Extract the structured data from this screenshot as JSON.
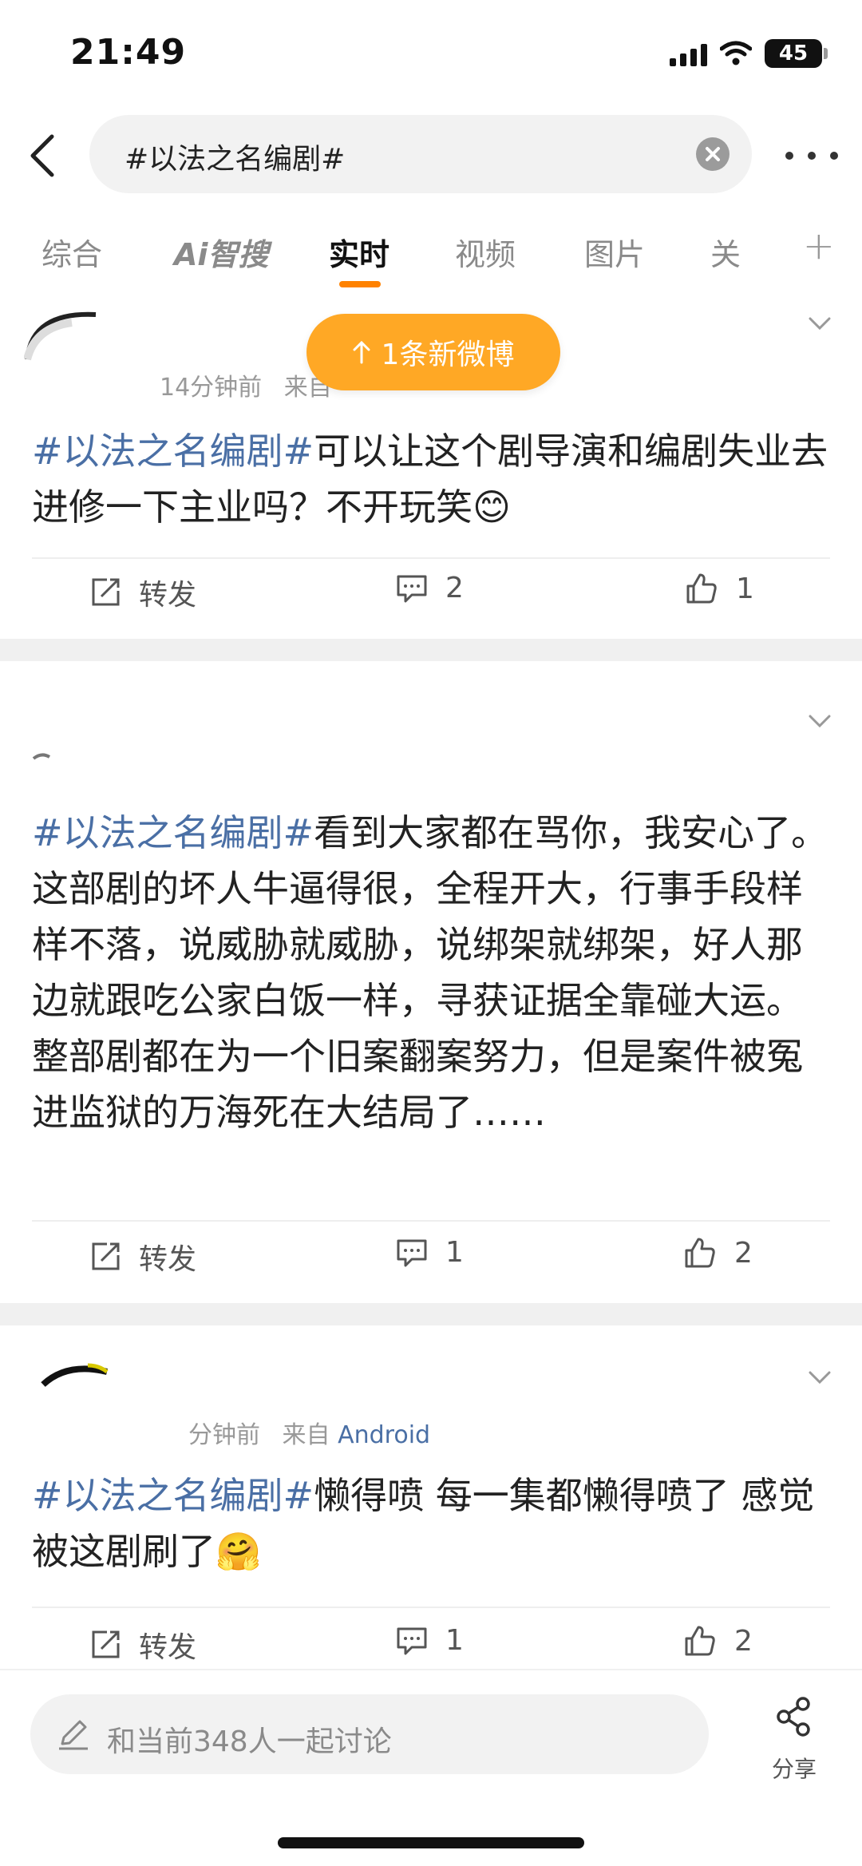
{
  "status_bar": {
    "time": "21:49",
    "battery": "45"
  },
  "search": {
    "query": "#以法之名编剧#"
  },
  "tabs": [
    {
      "label": "综合"
    },
    {
      "label": "Ai智搜"
    },
    {
      "label": "实时"
    },
    {
      "label": "视频"
    },
    {
      "label": "图片"
    },
    {
      "label": "关"
    }
  ],
  "new_posts_pill": {
    "label": "1条新微博"
  },
  "posts": [
    {
      "meta_time": "14分钟前",
      "meta_from": "来自",
      "hashtag": "#以法之名编剧#",
      "text": "可以让这个剧导演和编剧失业去进修一下主业吗？不开玩笑😊",
      "repost_label": "转发",
      "comment_count": "2",
      "like_count": "1"
    },
    {
      "hashtag": "#以法之名编剧#",
      "text": "看到大家都在骂你，我安心了。这部剧的坏人牛逼得很，全程开大，行事手段样样不落，说威胁就威胁，说绑架就绑架，好人那边就跟吃公家白饭一样，寻获证据全靠碰大运。整部剧都在为一个旧案翻案努力，但是案件被冤进监狱的万海死在大结局了……",
      "repost_label": "转发",
      "comment_count": "1",
      "like_count": "2"
    },
    {
      "meta_time": "分钟前",
      "meta_from": "来自",
      "meta_source": "Android",
      "hashtag": "#以法之名编剧#",
      "text": "懒得喷 每一集都懒得喷了 感觉被这剧刷了🤗",
      "repost_label": "转发",
      "comment_count": "1",
      "like_count": "2"
    }
  ],
  "bottom_bar": {
    "comment_placeholder": "和当前348人一起讨论",
    "share_label": "分享"
  },
  "colors": {
    "accent": "#ff8200",
    "pill": "#ffa825",
    "link": "#4a6fa5"
  }
}
